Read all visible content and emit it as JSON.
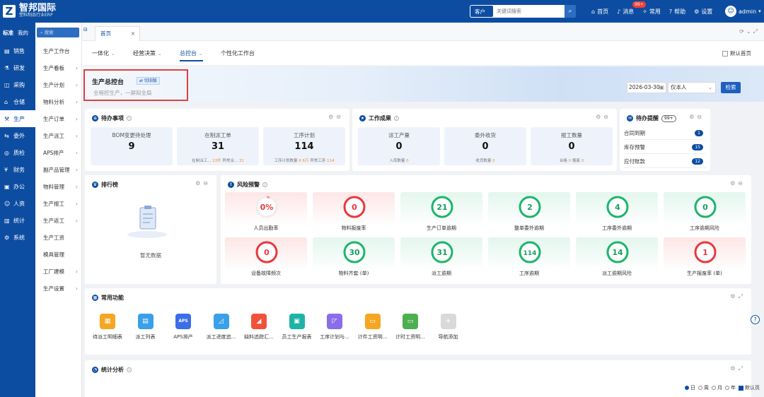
{
  "brand": {
    "logo_letter": "Z",
    "name": "智邦国际",
    "subtitle": "塑料制品行业ERP"
  },
  "top_search": {
    "type_label": "客户名称",
    "placeholder": "关键词搜索",
    "search_icon": "search-icon"
  },
  "top_actions": [
    {
      "label": "首页",
      "icon": "home-icon"
    },
    {
      "label": "消息",
      "icon": "bell-icon",
      "badge": "99+"
    },
    {
      "label": "常用",
      "icon": "gear-icon"
    },
    {
      "label": "帮助",
      "icon": "help-icon"
    },
    {
      "label": "设置",
      "icon": "settings-icon"
    }
  ],
  "user": {
    "name": "admin"
  },
  "left_nav": {
    "tabs": [
      "标准",
      "我的"
    ],
    "items": [
      {
        "label": "销售",
        "icon": "sales-icon"
      },
      {
        "label": "研发",
        "icon": "rd-icon"
      },
      {
        "label": "采购",
        "icon": "purchase-icon"
      },
      {
        "label": "仓储",
        "icon": "warehouse-icon"
      },
      {
        "label": "生产",
        "icon": "production-icon",
        "active": true
      },
      {
        "label": "委外",
        "icon": "outsource-icon"
      },
      {
        "label": "质检",
        "icon": "quality-icon"
      },
      {
        "label": "财务",
        "icon": "finance-icon"
      },
      {
        "label": "办公",
        "icon": "office-icon"
      },
      {
        "label": "人资",
        "icon": "hr-icon"
      },
      {
        "label": "统计",
        "icon": "stats-icon"
      },
      {
        "label": "系统",
        "icon": "system-icon"
      }
    ]
  },
  "sub_nav": {
    "search_placeholder": "搜索",
    "items": [
      "生产工作台",
      "生产看板",
      "生产计划",
      "物料分析",
      "生产订单",
      "生产派工",
      "APS排产",
      "副产品管理",
      "物料管理",
      "生产报工",
      "生产返工",
      "生产工资",
      "模具管理",
      "工厂建模",
      "生产设置"
    ]
  },
  "tab_bar": {
    "home_tab": "首页"
  },
  "sub_tabs": [
    {
      "label": "一体化"
    },
    {
      "label": "经营决策"
    },
    {
      "label": "总控台",
      "active": true
    },
    {
      "label": "个性化工作台"
    }
  ],
  "default_home": "默认首页",
  "hero": {
    "title": "生产总控台",
    "tag": "⇄ 切旧版",
    "subtitle": "全程控生产，一屏知全局",
    "date": "2026-03-30",
    "scope": "仅本人",
    "query_button": "检索"
  },
  "todo": {
    "title": "待办事项",
    "boxes": [
      {
        "label": "BOM变更待处理",
        "value": "9"
      },
      {
        "label": "在制派工单",
        "value": "31",
        "sub": [
          {
            "k": "在制派工...",
            "v": "13仟"
          },
          {
            "k": "异常派...",
            "v": "31"
          }
        ]
      },
      {
        "label": "工序计划",
        "value": "114",
        "sub": [
          {
            "k": "工序计划数量",
            "v": "6.6万"
          },
          {
            "k": "异常工序",
            "v": "114"
          }
        ]
      }
    ]
  },
  "results": {
    "title": "工作成果",
    "boxes": [
      {
        "label": "派工产量",
        "value": "0",
        "sub": [
          {
            "k": "入库数量",
            "v": "0"
          }
        ]
      },
      {
        "label": "委外收货",
        "value": "0",
        "sub": [
          {
            "k": "收货数量",
            "v": "0"
          }
        ]
      },
      {
        "label": "报工数量",
        "value": "0",
        "sub": [
          {
            "k": "合格",
            "v": "0"
          },
          {
            "k": "报废",
            "v": "0"
          }
        ]
      }
    ]
  },
  "reminders": {
    "title": "待办提醒",
    "count": "99+",
    "rows": [
      {
        "label": "合同到期",
        "count": "1"
      },
      {
        "label": "库存预警",
        "count": "15"
      },
      {
        "label": "应付账款",
        "count": "12"
      }
    ]
  },
  "ranking": {
    "title": "排行榜",
    "empty_text": "暂无数据"
  },
  "risk": {
    "title": "风险预警",
    "items": [
      {
        "label": "人员出勤率",
        "value": "0%",
        "tone": "red",
        "fill": 0.05,
        "color": "#f0a0a0"
      },
      {
        "label": "物料报废率",
        "value": "0",
        "tone": "red",
        "fill": 1,
        "color": "#e8383d"
      },
      {
        "label": "生产订单逾期",
        "value": "21",
        "tone": "green",
        "fill": 1,
        "color": "#1db56c"
      },
      {
        "label": "整单委外逾期",
        "value": "2",
        "tone": "green",
        "fill": 1,
        "color": "#1db56c"
      },
      {
        "label": "工序委外逾期",
        "value": "4",
        "tone": "green",
        "fill": 1,
        "color": "#1db56c"
      },
      {
        "label": "工序逾期风险",
        "value": "0",
        "tone": "green",
        "fill": 1,
        "color": "#1db56c"
      },
      {
        "label": "设备故障频次",
        "value": "0",
        "tone": "red",
        "fill": 1,
        "color": "#e8383d"
      },
      {
        "label": "物料齐套 (单)",
        "value": "30",
        "tone": "green",
        "fill": 1,
        "color": "#1db56c"
      },
      {
        "label": "派工逾期",
        "value": "31",
        "tone": "green",
        "fill": 1,
        "color": "#1db56c"
      },
      {
        "label": "工序逾期",
        "value": "114",
        "tone": "green",
        "fill": 1,
        "color": "#1db56c"
      },
      {
        "label": "派工逾期风险",
        "value": "14",
        "tone": "green",
        "fill": 1,
        "color": "#1db56c"
      },
      {
        "label": "生产报废率 (单)",
        "value": "1",
        "tone": "red",
        "fill": 1,
        "color": "#e8383d"
      }
    ]
  },
  "common": {
    "title": "常用功能",
    "items": [
      {
        "label": "待派工明细表",
        "color": "#f5a623",
        "glyph": "▦"
      },
      {
        "label": "派工列表",
        "color": "#3aa0e8",
        "glyph": "▤"
      },
      {
        "label": "APS排产",
        "color": "#3b6ee8",
        "glyph": "APS"
      },
      {
        "label": "派工进度追...",
        "color": "#3aa0e8",
        "glyph": "◿"
      },
      {
        "label": "缺料追踪汇...",
        "color": "#f0533a",
        "glyph": "◢"
      },
      {
        "label": "员工生产报表",
        "color": "#1fb3a8",
        "glyph": "▣"
      },
      {
        "label": "工序计划与...",
        "color": "#8a6de8",
        "glyph": "◸"
      },
      {
        "label": "计件工资明...",
        "color": "#f5a623",
        "glyph": "▭"
      },
      {
        "label": "计时工资明...",
        "color": "#4caf50",
        "glyph": "▭"
      },
      {
        "label": "导航添加",
        "color": "#d9d9d9",
        "glyph": "+"
      }
    ]
  },
  "stats": {
    "title": "统计分析",
    "periods": [
      "日",
      "周",
      "月",
      "年"
    ],
    "default_label": "默认页"
  }
}
